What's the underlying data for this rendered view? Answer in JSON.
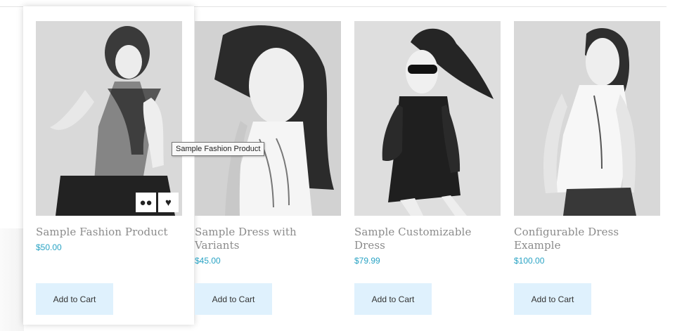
{
  "products": [
    {
      "title": "Sample Fashion Product",
      "price": "$50.00",
      "button": "Add to Cart"
    },
    {
      "title": "Sample Dress with Variants",
      "price": "$45.00",
      "button": "Add to Cart"
    },
    {
      "title": "Sample Customizable Dress",
      "price": "$79.99",
      "button": "Add to Cart"
    },
    {
      "title": "Configurable Dress Example",
      "price": "$100.00",
      "button": "Add to Cart"
    }
  ],
  "quick_actions": {
    "compare_icon": "compare-icon",
    "wishlist_icon": "heart-icon"
  },
  "tooltip": "Sample Fashion Product",
  "colors": {
    "price": "#29a3c4",
    "button_background": "#dff1fd",
    "title": "#8b8b8b"
  }
}
